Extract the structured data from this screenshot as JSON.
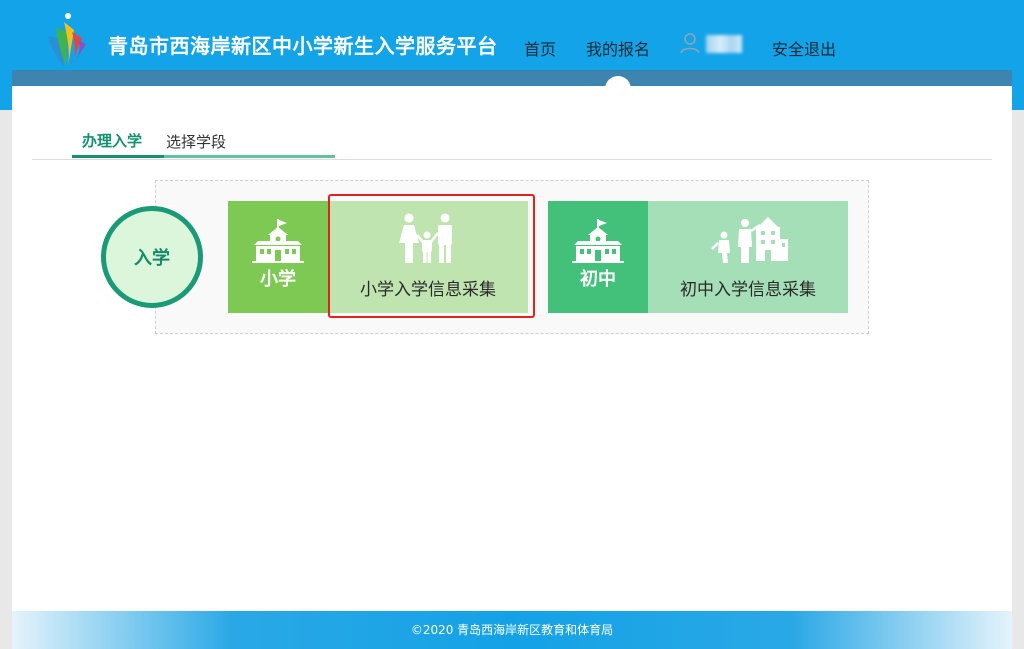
{
  "header": {
    "site_title": "青岛市西海岸新区中小学新生入学服务平台",
    "nav": {
      "home": "首页",
      "my_registration": "我的报名",
      "logout": "安全退出"
    }
  },
  "tabs": {
    "active": "办理入学",
    "other": "选择学段"
  },
  "enroll_label": "入学",
  "levels": [
    {
      "label": "小学",
      "collect_label": "小学入学信息采集",
      "color": "#7dc953",
      "card_color": "#c0e4b0"
    },
    {
      "label": "初中",
      "collect_label": "初中入学信息采集",
      "color": "#43c079",
      "card_color": "#a4dfb7"
    }
  ],
  "footer": {
    "copyright": "©2020 青岛西海岸新区教育和体育局"
  },
  "colors": {
    "header": "#12a3e8",
    "accent": "#139171",
    "highlight": "#e0231e"
  },
  "icons": [
    "logo",
    "user-icon",
    "school-icon",
    "family-icon",
    "students-icon"
  ]
}
